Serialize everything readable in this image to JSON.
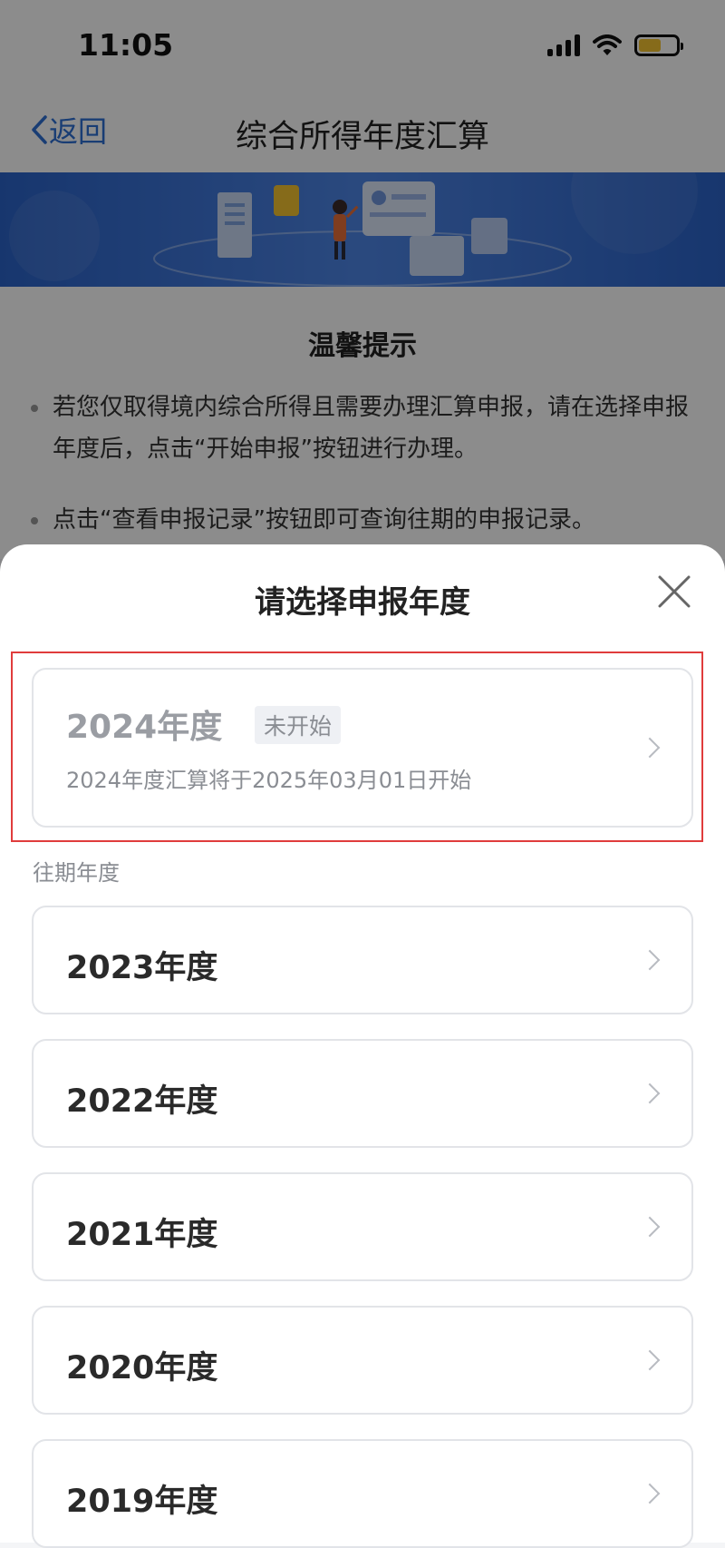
{
  "status_bar": {
    "time": "11:05",
    "battery_level": 0.6
  },
  "nav": {
    "back_label": "返回",
    "title": "综合所得年度汇算"
  },
  "tips": {
    "title": "温馨提示",
    "items": [
      "若您仅取得境内综合所得且需要办理汇算申报，请在选择申报年度后，点击“开始申报”按钮进行办理。",
      "点击“查看申报记录”按钮即可查询往期的申报记录。"
    ]
  },
  "sheet": {
    "title": "请选择申报年度",
    "current": {
      "year": "2024年度",
      "badge": "未开始",
      "desc": "2024年度汇算将于2025年03月01日开始"
    },
    "past_label": "往期年度",
    "past_years": [
      "2023年度",
      "2022年度",
      "2021年度",
      "2020年度",
      "2019年度"
    ]
  },
  "colors": {
    "accent": "#2f6fd4",
    "banner": "#2b63c9",
    "highlight": "#e03c3c",
    "battery": "#f5c431"
  }
}
